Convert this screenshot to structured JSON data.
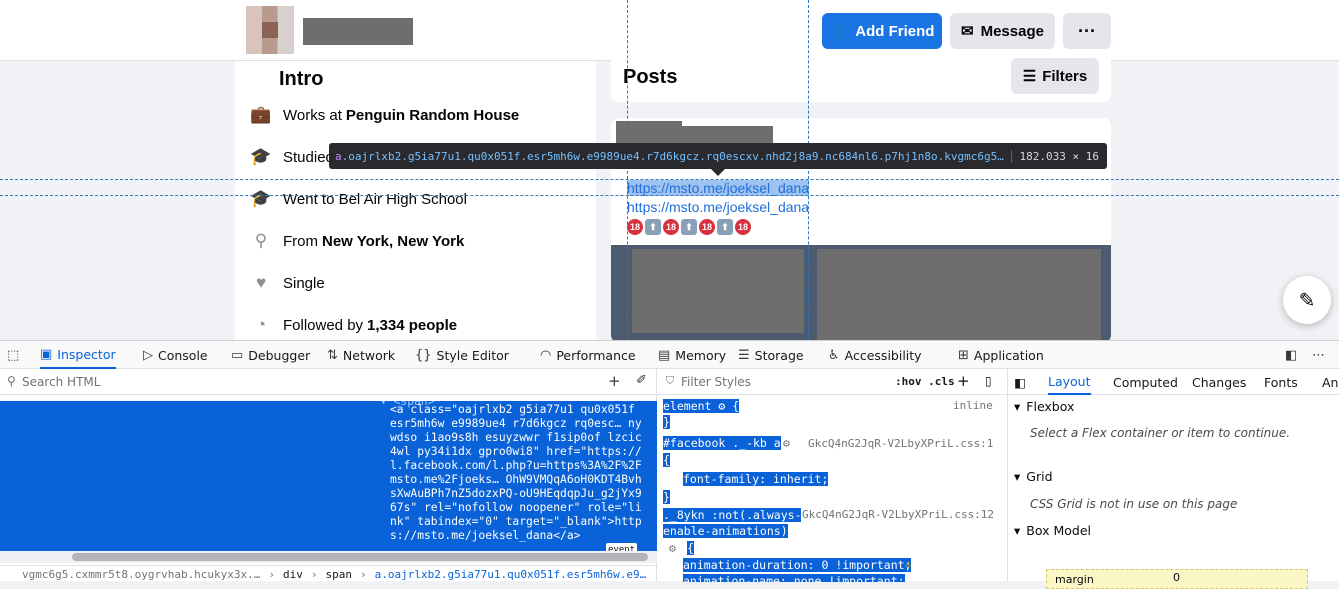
{
  "header": {
    "add_friend": "Add Friend",
    "message": "Message",
    "more": "···"
  },
  "intro": {
    "title": "Intro",
    "rows": [
      {
        "icon": "briefcase-icon",
        "prefix": "Works at",
        "bold": "Penguin Random House"
      },
      {
        "icon": "graduation-cap-icon",
        "prefix": "Studied",
        "bold": ""
      },
      {
        "icon": "graduation-cap-icon",
        "prefix": "Went to Bel Air High School",
        "bold": ""
      },
      {
        "icon": "location-pin-icon",
        "prefix": "From",
        "bold": "New York, New York"
      },
      {
        "icon": "heart-icon",
        "prefix": "Single",
        "bold": ""
      },
      {
        "icon": "rss-icon",
        "prefix": "Followed by",
        "bold": "1,334 people"
      }
    ]
  },
  "posts": {
    "title": "Posts",
    "filters": "Filters",
    "link1": "https://msto.me/joeksel_dana",
    "link2": "https://msto.me/joeksel_dana"
  },
  "tooltip": {
    "tag": "a",
    "classes": ".oajrlxb2.g5ia77u1.qu0x051f.esr5mh6w.e9989ue4.r7d6kgcz.rq0escxv.nhd2j8a9.nc684nl6.p7hj1n8o.kvgmc6g5…",
    "dims": "182.033 × 16"
  },
  "devtools": {
    "tabs": [
      "Inspector",
      "Console",
      "Debugger",
      "Network",
      "Style Editor",
      "Performance",
      "Memory",
      "Storage",
      "Accessibility",
      "Application"
    ],
    "search_placeholder": "Search HTML",
    "span_line": "▾ <span>",
    "html_code": "<a class=\"oajrlxb2 g5ia77u1 qu0x051f esr5mh6w e9989ue4 r7d6kgcz rq0esc… nywdso i1ao9s8h esuyzwwr f1sip0of lzcic4wl py34i1dx gpro0wi8\" href=\"https://l.facebook.com/l.php?u=https%3A%2F%2Fmsto.me%2Fjoeks… OhW9VMQqA6oH0KDT4BvhsXwAuBPh7nZ5dozxPQ-oU9HEqdqpJu_g2jYx967s\" rel=\"nofollow noopener\" role=\"link\" tabindex=\"0\" target=\"_blank\">https://msto.me/joeksel_dana</a>",
    "event_badge": "event",
    "breadcrumbs": [
      "vgmc6g5.cxmmr5t8.oygrvhab.hcukyx3x.…",
      "div",
      "span",
      "a.oajrlxb2.g5ia77u1.qu0x051f.esr5mh6w.e9…"
    ],
    "filter_placeholder": "Filter Styles",
    "hov_cls": ":hov .cls",
    "rules": {
      "r1_selector": "element",
      "r1_source": "inline",
      "r2_selector": "#facebook ._-kb a",
      "r2_source": "GkcQ4nG2JqR-V2LbyXPriL.css:1",
      "r2_prop": "font-family: inherit;",
      "r3_selector_a": "._8ykn :not(.always-",
      "r3_selector_b": "enable-animations)",
      "r3_source": "GkcQ4nG2JqR-V2LbyXPriL.css:12",
      "r3_prop1": "animation-duration: 0 !important;",
      "r3_prop2": "animation-name: none !important;"
    },
    "layout_tabs": [
      "Layout",
      "Computed",
      "Changes",
      "Fonts",
      "Ani"
    ],
    "flexbox_title": "Flexbox",
    "flexbox_text": "Select a Flex container or item to continue.",
    "grid_title": "Grid",
    "grid_text": "CSS Grid is not in use on this page",
    "boxmodel_title": "Box Model",
    "margin_label": "margin",
    "margin_value": "0"
  }
}
